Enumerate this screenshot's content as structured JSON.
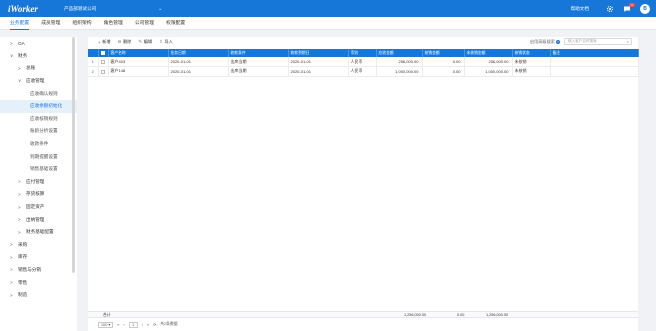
{
  "header": {
    "logo": "iWorker",
    "company": "产品部测试公司",
    "caret": "⌄",
    "help": "帮助文档",
    "notification_count": "2",
    "avatar_letter": "B"
  },
  "nav": {
    "tabs": [
      "业务配置",
      "成员管理",
      "组织架构",
      "角色管理",
      "公司管理",
      "权限配置"
    ],
    "active_index": 0
  },
  "sidebar": {
    "items": [
      {
        "label": "OA",
        "level": 0,
        "arrow": ">"
      },
      {
        "label": "财务",
        "level": 0,
        "arrow": "∨"
      },
      {
        "label": "总账",
        "level": 1,
        "arrow": ">"
      },
      {
        "label": "应收管理",
        "level": 1,
        "arrow": "∨"
      },
      {
        "label": "应收确认规则",
        "level": 2,
        "arrow": ""
      },
      {
        "label": "应收余额初始化",
        "level": 2,
        "arrow": "",
        "active": true
      },
      {
        "label": "应收核销规则",
        "level": 2,
        "arrow": ""
      },
      {
        "label": "账龄分析设置",
        "level": 2,
        "arrow": ""
      },
      {
        "label": "收款条件",
        "level": 2,
        "arrow": ""
      },
      {
        "label": "到期提醒设置",
        "level": 2,
        "arrow": ""
      },
      {
        "label": "销售基础设置",
        "level": 2,
        "arrow": ""
      },
      {
        "label": "应付管理",
        "level": 1,
        "arrow": ">"
      },
      {
        "label": "存货核算",
        "level": 1,
        "arrow": ">"
      },
      {
        "label": "固定资产",
        "level": 1,
        "arrow": ">"
      },
      {
        "label": "出纳管理",
        "level": 1,
        "arrow": ">"
      },
      {
        "label": "财务基础配置",
        "level": 1,
        "arrow": ">"
      },
      {
        "label": "采购",
        "level": 0,
        "arrow": ">"
      },
      {
        "label": "库存",
        "level": 0,
        "arrow": ">"
      },
      {
        "label": "销售与分销",
        "level": 0,
        "arrow": ">"
      },
      {
        "label": "零售",
        "level": 0,
        "arrow": ">"
      },
      {
        "label": "制造",
        "level": 0,
        "arrow": ">"
      }
    ]
  },
  "toolbar": {
    "add": "新增",
    "delete": "删除",
    "edit": "编辑",
    "import": "导入",
    "add_icon": "+",
    "delete_icon": "⊖",
    "edit_icon": "✎",
    "import_icon": "⇪",
    "advanced_search": "启用高级搜索",
    "help_mark": "?",
    "search_placeholder": "输入客户名称搜索",
    "search_icon": "⌕"
  },
  "table": {
    "columns": [
      "",
      "",
      "客户名称",
      "业务日期",
      "收款条件",
      "收款到期日",
      "币别",
      "应收金额",
      "核销金额",
      "未核销金额",
      "核销状态",
      "备注"
    ],
    "rows": [
      {
        "index": "1",
        "customer": "客户403",
        "date": "2020-01-01",
        "terms": "出库当期",
        "due": "2020-01-01",
        "currency": "人民币",
        "receivable": "256,000.00",
        "written_off": "0.00",
        "remaining": "256,000.00",
        "status": "未核销",
        "note": ""
      },
      {
        "index": "2",
        "customer": "客户148",
        "date": "2020-01-01",
        "terms": "出库当期",
        "due": "2020-01-01",
        "currency": "人民币",
        "receivable": "1,000,000.00",
        "written_off": "0.00",
        "remaining": "1,000,000.00",
        "status": "未核销",
        "note": ""
      }
    ]
  },
  "totals": {
    "label": "合计",
    "receivable": "1,256,000.00",
    "written_off": "0.00",
    "remaining": "1,256,000.00"
  },
  "pager": {
    "page_size": "100 ▾",
    "first": "«",
    "prev": "‹",
    "page": "1",
    "next": "›",
    "last": "»",
    "refresh": "⟳",
    "total_text": "共2条数据"
  }
}
